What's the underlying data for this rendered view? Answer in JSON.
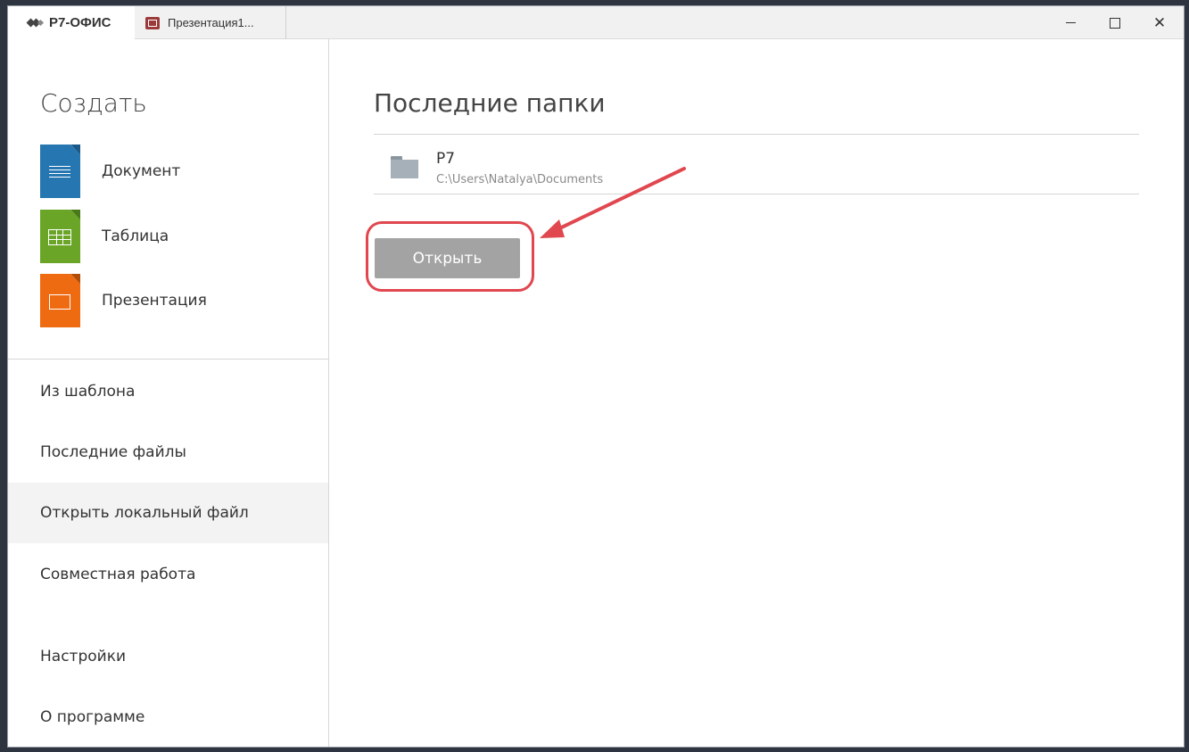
{
  "titlebar": {
    "brand": "Р7-ОФИС",
    "open_tab_label": "Презентация1...",
    "controls": [
      "minimize-icon",
      "maximize-icon",
      "close-icon"
    ]
  },
  "create": {
    "title": "Создать",
    "items": [
      {
        "label": "Документ",
        "icon": "document-file-icon",
        "color": "#2677b1"
      },
      {
        "label": "Таблица",
        "icon": "spreadsheet-file-icon",
        "color": "#6aa528"
      },
      {
        "label": "Презентация",
        "icon": "presentation-file-icon",
        "color": "#ef6b12"
      }
    ]
  },
  "nav": {
    "items": [
      {
        "label": "Из шаблона"
      },
      {
        "label": "Последние файлы"
      },
      {
        "label": "Открыть локальный файл",
        "active": true
      },
      {
        "label": "Совместная работа"
      },
      {
        "label": "Настройки"
      },
      {
        "label": "О программе"
      }
    ]
  },
  "recent": {
    "title": "Последние папки",
    "folders": [
      {
        "name": "P7",
        "path": "C:\\Users\\Natalya\\Documents",
        "icon": "folder-icon"
      }
    ],
    "open_button": "Открыть"
  },
  "annotation": {
    "color": "#e0474f",
    "shapes": [
      "highlight-ring",
      "arrow-icon"
    ]
  }
}
